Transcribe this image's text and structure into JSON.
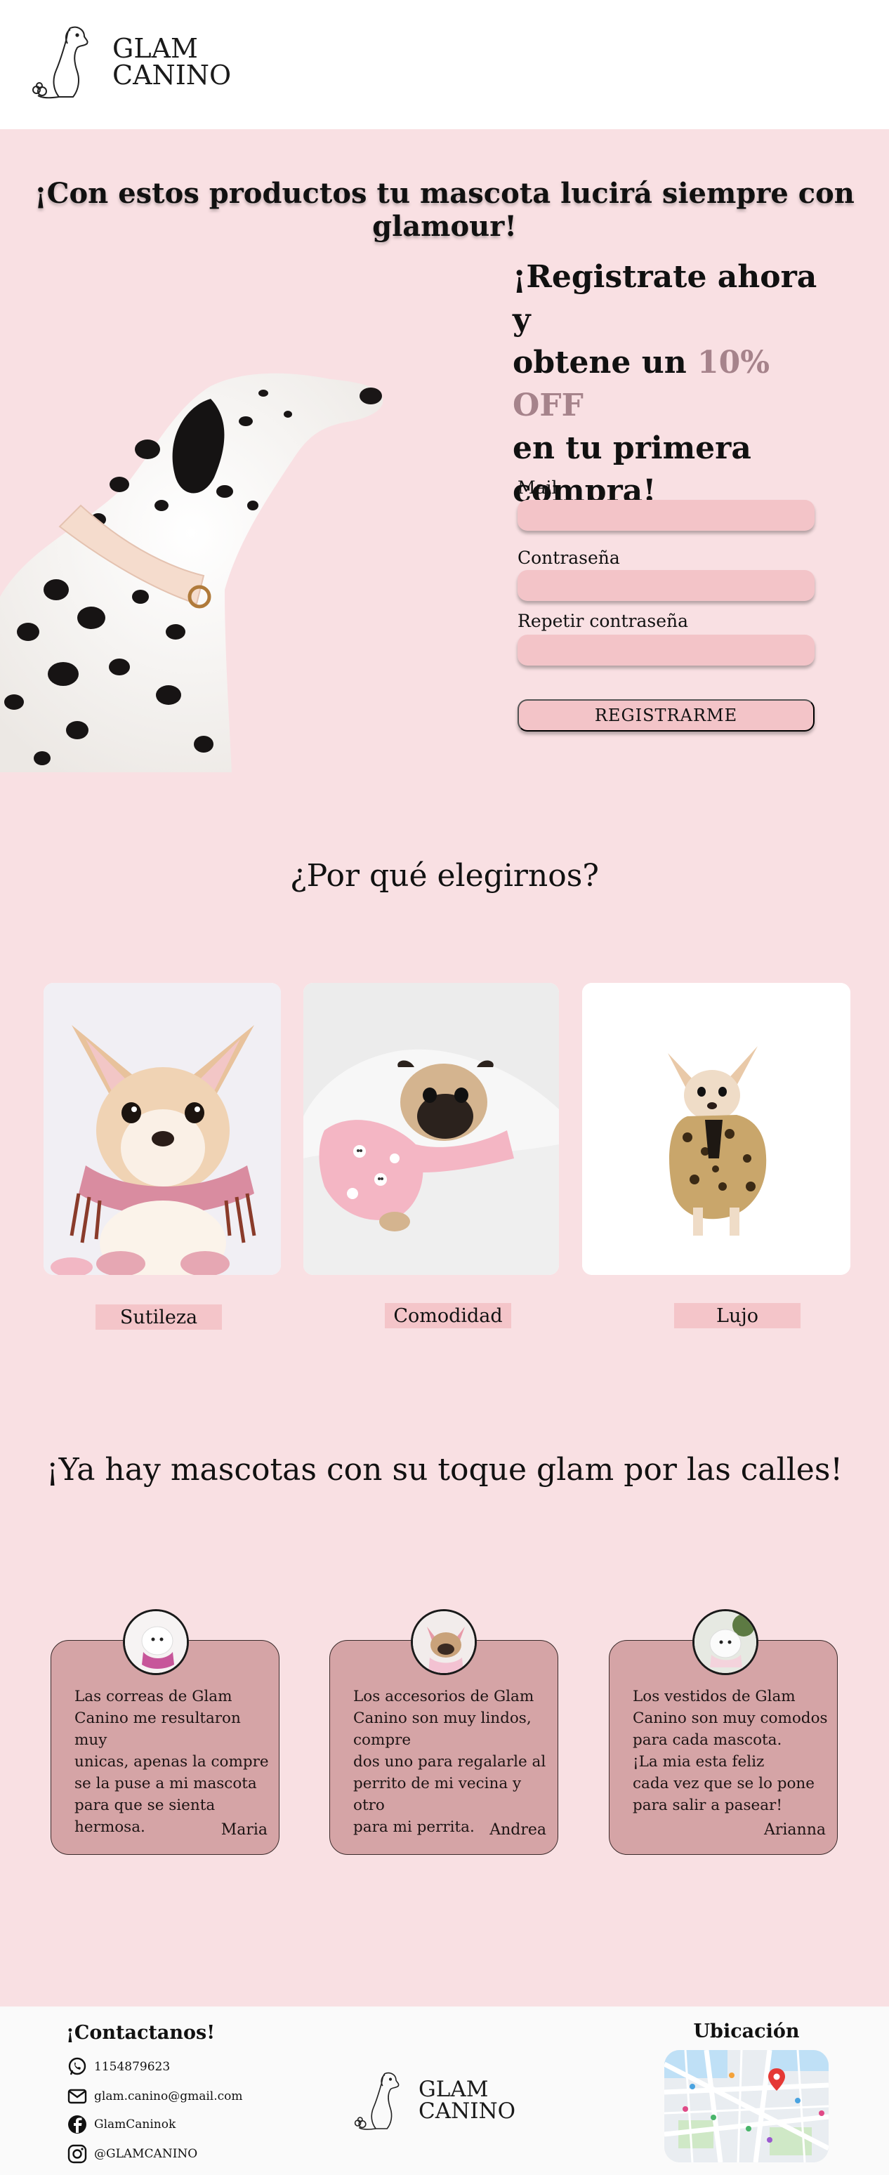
{
  "header": {
    "logo_line1": "GLAM",
    "logo_line2": "CANINO"
  },
  "hero": {
    "tagline": "¡Con estos productos tu mascota lucirá siempre con glamour!"
  },
  "promo": {
    "line1": "¡Registrate ahora y",
    "line2_prefix": "obtene un ",
    "line2_highlight": "10% OFF",
    "line3": "en tu primera",
    "line4": "compra!"
  },
  "form": {
    "mail_label": "Mail",
    "password_label": "Contraseña",
    "repeat_label": "Repetir contraseña",
    "submit_label": "REGISTRARME"
  },
  "why": {
    "title": "¿Por qué elegirnos?",
    "features": [
      "Sutileza",
      "Comodidad",
      "Lujo"
    ]
  },
  "testimonials": {
    "title": "¡Ya hay mascotas con su toque glam por las calles!",
    "items": [
      {
        "text": "Las correas de Glam\nCanino me resultaron muy\nunicas, apenas la compre\nse la puse a mi mascota\npara que se sienta hermosa.",
        "author": "Maria"
      },
      {
        "text": "Los accesorios de Glam\nCanino son muy lindos,\ncompre\ndos uno para regalarle al\nperrito de mi vecina y otro\npara mi perrita.",
        "author": "Andrea"
      },
      {
        "text": "Los vestidos de Glam\nCanino son muy comodos\npara cada mascota.\n¡La mia esta feliz\ncada vez que se lo pone\npara salir a pasear!",
        "author": "Arianna"
      }
    ]
  },
  "footer": {
    "contact_title": "¡Contactanos!",
    "phone": "1154879623",
    "email": "glam.canino@gmail.com",
    "facebook": "GlamCaninok",
    "instagram": "@GLAMCANINO",
    "location_title": "Ubicación",
    "logo_line1": "GLAM",
    "logo_line2": "CANINO"
  },
  "colors": {
    "page_pink": "#f9e0e3",
    "field_pink": "#f3c4c8",
    "card_rose": "#d5a4a6",
    "accent_mauve": "#a6838b"
  },
  "icons": [
    "dog-logo-icon",
    "whatsapp-icon",
    "mail-icon",
    "facebook-icon",
    "instagram-icon",
    "map-pin-icon"
  ]
}
